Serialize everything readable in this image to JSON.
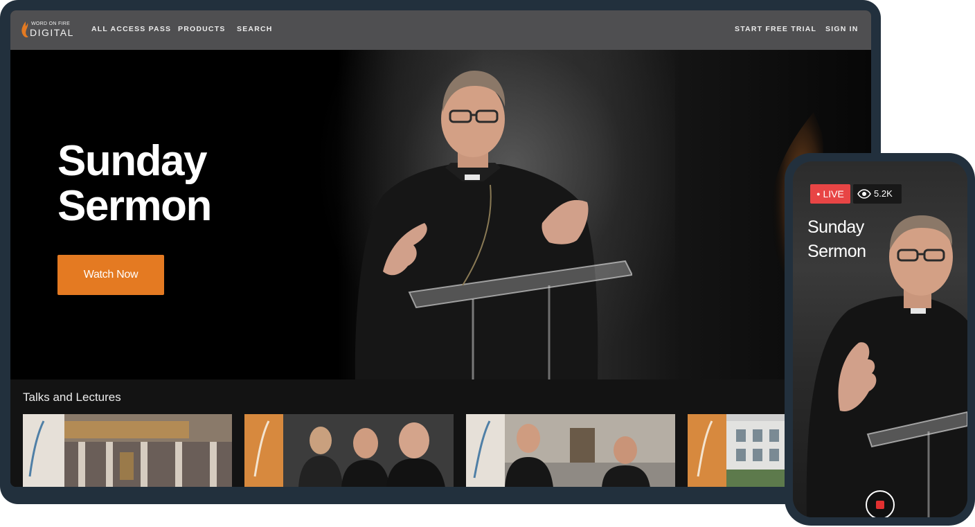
{
  "brand": {
    "logo_line1": "WORD ON FIRE",
    "logo_line2": "DIGITAL",
    "accent_color": "#e47a22"
  },
  "nav": {
    "left_links": [
      "ALL ACCESS PASS",
      "PRODUCTS",
      "SEARCH"
    ],
    "right_links": [
      "START FREE TRIAL",
      "SIGN IN"
    ]
  },
  "hero": {
    "title": "Sunday Sermon",
    "button_label": "Watch Now"
  },
  "rail": {
    "title": "Talks and Lectures",
    "thumbnails": [
      {
        "name": "basilica-interior"
      },
      {
        "name": "synod-panel"
      },
      {
        "name": "synod-courtyard"
      },
      {
        "name": "synod-building"
      }
    ]
  },
  "phone": {
    "live_label": "LIVE",
    "viewer_count": "5.2K",
    "title": "Sunday Sermon",
    "live_color": "#e84545",
    "icons": [
      "eye-icon",
      "stop-record-icon"
    ]
  }
}
